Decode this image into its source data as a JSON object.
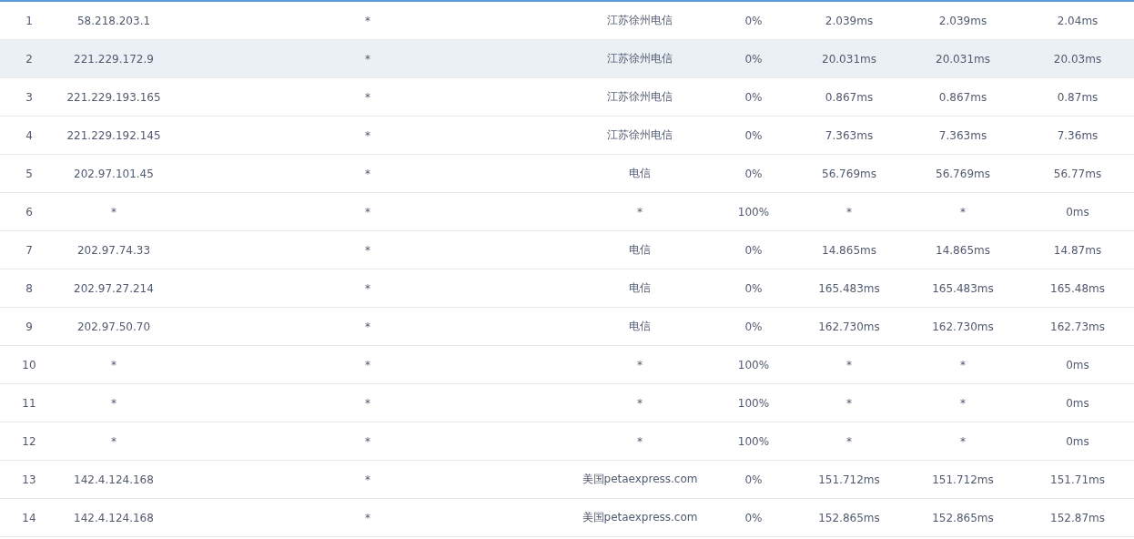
{
  "rows": [
    {
      "hop": "1",
      "ip": "58.218.203.1",
      "host": "*",
      "location": "江苏徐州电信",
      "loss": "0%",
      "best": "2.039ms",
      "worst": "2.039ms",
      "avg": "2.04ms",
      "highlighted": false
    },
    {
      "hop": "2",
      "ip": "221.229.172.9",
      "host": "*",
      "location": "江苏徐州电信",
      "loss": "0%",
      "best": "20.031ms",
      "worst": "20.031ms",
      "avg": "20.03ms",
      "highlighted": true
    },
    {
      "hop": "3",
      "ip": "221.229.193.165",
      "host": "*",
      "location": "江苏徐州电信",
      "loss": "0%",
      "best": "0.867ms",
      "worst": "0.867ms",
      "avg": "0.87ms",
      "highlighted": false
    },
    {
      "hop": "4",
      "ip": "221.229.192.145",
      "host": "*",
      "location": "江苏徐州电信",
      "loss": "0%",
      "best": "7.363ms",
      "worst": "7.363ms",
      "avg": "7.36ms",
      "highlighted": false
    },
    {
      "hop": "5",
      "ip": "202.97.101.45",
      "host": "*",
      "location": "电信",
      "loss": "0%",
      "best": "56.769ms",
      "worst": "56.769ms",
      "avg": "56.77ms",
      "highlighted": false
    },
    {
      "hop": "6",
      "ip": "*",
      "host": "*",
      "location": "*",
      "loss": "100%",
      "best": "*",
      "worst": "*",
      "avg": "0ms",
      "highlighted": false
    },
    {
      "hop": "7",
      "ip": "202.97.74.33",
      "host": "*",
      "location": "电信",
      "loss": "0%",
      "best": "14.865ms",
      "worst": "14.865ms",
      "avg": "14.87ms",
      "highlighted": false
    },
    {
      "hop": "8",
      "ip": "202.97.27.214",
      "host": "*",
      "location": "电信",
      "loss": "0%",
      "best": "165.483ms",
      "worst": "165.483ms",
      "avg": "165.48ms",
      "highlighted": false
    },
    {
      "hop": "9",
      "ip": "202.97.50.70",
      "host": "*",
      "location": "电信",
      "loss": "0%",
      "best": "162.730ms",
      "worst": "162.730ms",
      "avg": "162.73ms",
      "highlighted": false
    },
    {
      "hop": "10",
      "ip": "*",
      "host": "*",
      "location": "*",
      "loss": "100%",
      "best": "*",
      "worst": "*",
      "avg": "0ms",
      "highlighted": false
    },
    {
      "hop": "11",
      "ip": "*",
      "host": "*",
      "location": "*",
      "loss": "100%",
      "best": "*",
      "worst": "*",
      "avg": "0ms",
      "highlighted": false
    },
    {
      "hop": "12",
      "ip": "*",
      "host": "*",
      "location": "*",
      "loss": "100%",
      "best": "*",
      "worst": "*",
      "avg": "0ms",
      "highlighted": false
    },
    {
      "hop": "13",
      "ip": "142.4.124.168",
      "host": "*",
      "location": "美国petaexpress.com",
      "loss": "0%",
      "best": "151.712ms",
      "worst": "151.712ms",
      "avg": "151.71ms",
      "highlighted": false
    },
    {
      "hop": "14",
      "ip": "142.4.124.168",
      "host": "*",
      "location": "美国petaexpress.com",
      "loss": "0%",
      "best": "152.865ms",
      "worst": "152.865ms",
      "avg": "152.87ms",
      "highlighted": false
    }
  ]
}
